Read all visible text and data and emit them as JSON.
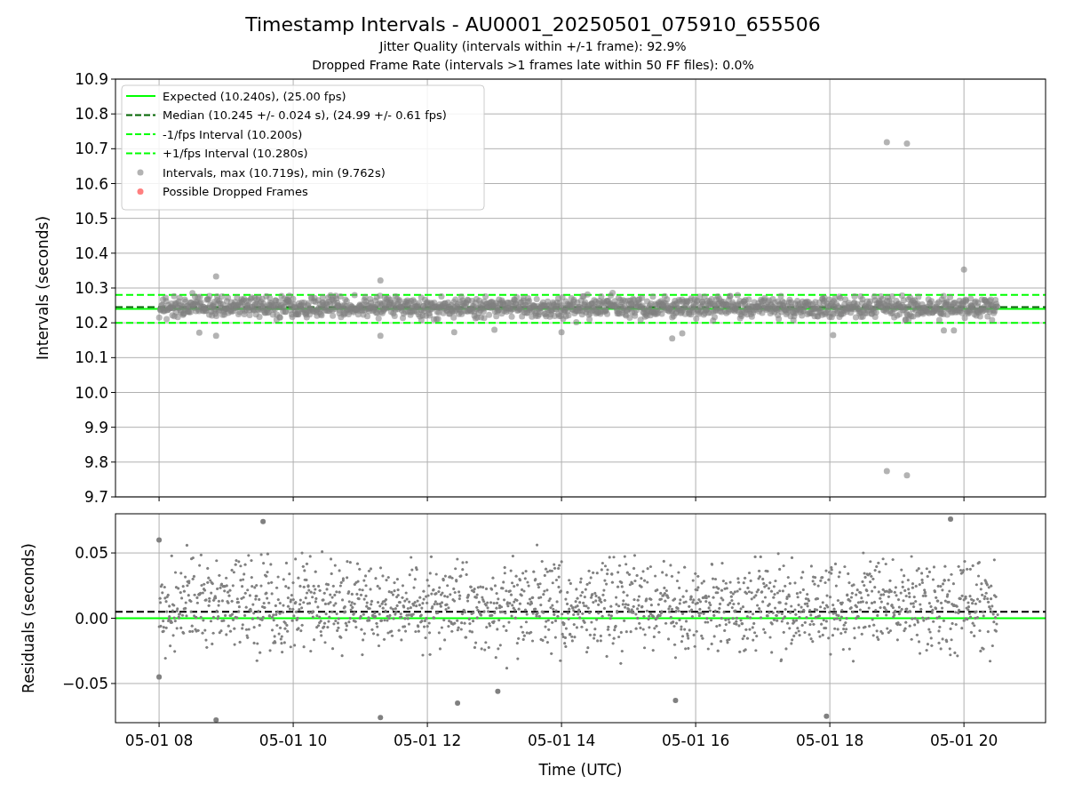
{
  "figure": {
    "title": "Timestamp Intervals - AU0001_20250501_075910_655506",
    "subtitles": [
      "Jitter Quality (intervals within +/-1 frame): 92.9%",
      "Dropped Frame Rate (intervals >1 frames late within 50 FF files): 0.0%"
    ]
  },
  "intervals_panel": {
    "chart_data": {
      "type": "scatter",
      "ylabel": "Intervals (seconds)",
      "xlim": [
        "2025-05-01 07:21",
        "2025-05-01 21:13"
      ],
      "ylim": [
        9.7,
        10.9
      ],
      "grid": true,
      "legend": true,
      "yticks": [
        {
          "value": 9.7,
          "label": "9.7"
        },
        {
          "value": 9.8,
          "label": "9.8"
        },
        {
          "value": 9.9,
          "label": "9.9"
        },
        {
          "value": 10.0,
          "label": "10.0"
        },
        {
          "value": 10.1,
          "label": "10.1"
        },
        {
          "value": 10.2,
          "label": "10.2"
        },
        {
          "value": 10.3,
          "label": "10.3"
        },
        {
          "value": 10.4,
          "label": "10.4"
        },
        {
          "value": 10.5,
          "label": "10.5"
        },
        {
          "value": 10.6,
          "label": "10.6"
        },
        {
          "value": 10.7,
          "label": "10.7"
        },
        {
          "value": 10.8,
          "label": "10.8"
        },
        {
          "value": 10.9,
          "label": "10.9"
        }
      ],
      "ref_lines": [
        {
          "axis": "y",
          "value": 10.24,
          "label": "Expected (10.240s), (25.00 fps)",
          "color": "#00ff00"
        },
        {
          "axis": "y",
          "value": 10.245,
          "label": "Median (10.245 +/- 0.024 s), (24.99 +/- 0.61 fps)",
          "color": "#006400"
        },
        {
          "axis": "y",
          "value": 10.2,
          "label": "-1/fps Interval (10.200s)",
          "color": "#00ff00"
        },
        {
          "axis": "y",
          "value": 10.28,
          "label": "+1/fps Interval (10.280s)",
          "color": "#00ff00"
        }
      ],
      "series": [
        {
          "name": "Intervals, max (10.719s), min (9.762s)",
          "color": "#808080",
          "x": [
            "2025-05-01 18:51",
            "2025-05-01 19:09",
            "2025-05-01 18:51",
            "2025-05-01 19:09",
            "2025-05-01 08:51",
            "2025-05-01 11:18",
            "2025-05-01 20:00",
            "2025-05-01 08:36",
            "2025-05-01 08:51",
            "2025-05-01 11:18",
            "2025-05-01 12:24",
            "2025-05-01 13:00",
            "2025-05-01 14:00",
            "2025-05-01 15:39",
            "2025-05-01 15:48",
            "2025-05-01 18:03",
            "2025-05-01 19:42",
            "2025-05-01 19:51"
          ],
          "values": [
            10.719,
            10.715,
            9.774,
            9.762,
            10.333,
            10.322,
            10.353,
            10.172,
            10.163,
            10.163,
            10.173,
            10.18,
            10.173,
            10.155,
            10.17,
            10.165,
            10.178,
            10.178
          ]
        },
        {
          "name": "Possible Dropped Frames",
          "color": "#ff0000",
          "x": [
            null
          ],
          "values": [
            null
          ]
        }
      ]
    }
  },
  "residuals_panel": {
    "chart_data": {
      "type": "scatter",
      "xlabel": "Time (UTC)",
      "ylabel": "Residuals (seconds)",
      "xlim": [
        "2025-05-01 07:21",
        "2025-05-01 21:13"
      ],
      "ylim": [
        -0.08,
        0.08
      ],
      "grid": true,
      "xticks": [
        {
          "value": "2025-05-01 08:00",
          "label": "05-01 08"
        },
        {
          "value": "2025-05-01 10:00",
          "label": "05-01 10"
        },
        {
          "value": "2025-05-01 12:00",
          "label": "05-01 12"
        },
        {
          "value": "2025-05-01 14:00",
          "label": "05-01 14"
        },
        {
          "value": "2025-05-01 16:00",
          "label": "05-01 16"
        },
        {
          "value": "2025-05-01 18:00",
          "label": "05-01 18"
        },
        {
          "value": "2025-05-01 20:00",
          "label": "05-01 20"
        }
      ],
      "yticks": [
        {
          "value": -0.05,
          "label": "−0.05"
        },
        {
          "value": 0,
          "label": "0.00"
        },
        {
          "value": 0.05,
          "label": "0.05"
        }
      ],
      "ref_lines": [
        {
          "axis": "y",
          "value": 0,
          "color": "#00ff00"
        },
        {
          "axis": "y",
          "value": 0.005,
          "color": "#000000"
        }
      ],
      "series": [
        {
          "color": "#808080",
          "x": [
            "2025-05-01 08:51",
            "2025-05-01 09:33",
            "2025-05-01 11:18",
            "2025-05-01 12:27",
            "2025-05-01 13:03",
            "2025-05-01 17:57",
            "2025-05-01 19:48",
            "2025-05-01 08:00",
            "2025-05-01 08:00",
            "2025-05-01 15:42"
          ],
          "values": [
            -0.078,
            0.074,
            -0.076,
            -0.065,
            -0.056,
            -0.075,
            0.076,
            0.06,
            -0.045,
            -0.063
          ]
        }
      ]
    }
  }
}
